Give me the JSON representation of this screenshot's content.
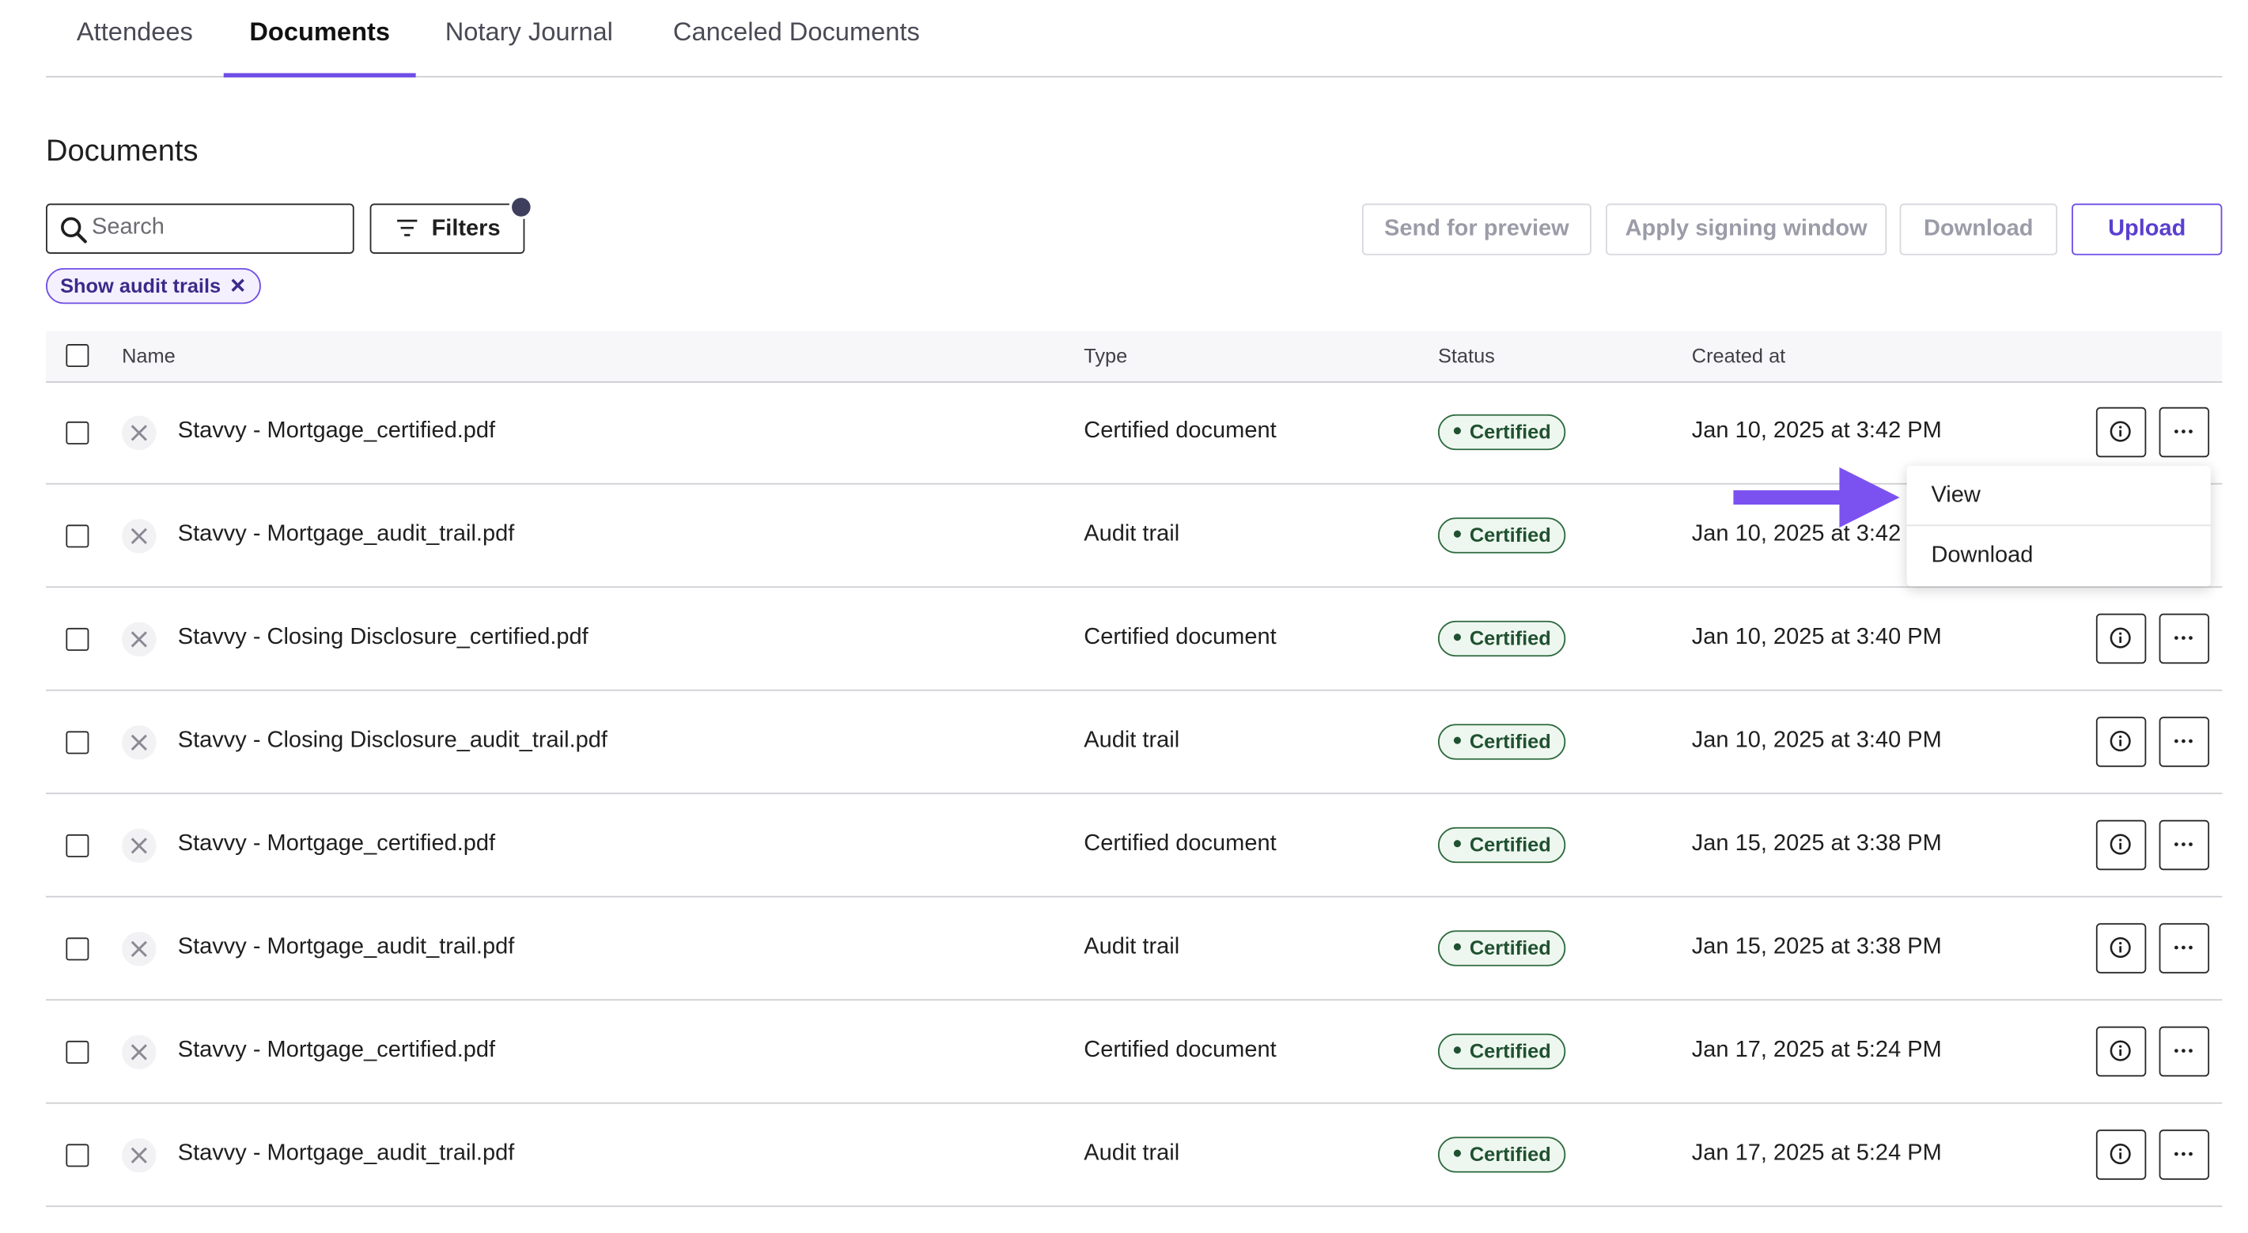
{
  "tabs": [
    {
      "label": "Attendees",
      "active": false
    },
    {
      "label": "Documents",
      "active": true
    },
    {
      "label": "Notary Journal",
      "active": false
    },
    {
      "label": "Canceled Documents",
      "active": false
    }
  ],
  "section_title": "Documents",
  "search": {
    "placeholder": "Search",
    "value": ""
  },
  "filters": {
    "label": "Filters",
    "has_active": true
  },
  "chip": {
    "label": "Show audit trails"
  },
  "actions": {
    "send_for_preview": "Send for preview",
    "apply_signing_window": "Apply signing window",
    "download": "Download",
    "upload": "Upload"
  },
  "table": {
    "headers": {
      "name": "Name",
      "type": "Type",
      "status": "Status",
      "created_at": "Created at"
    },
    "rows": [
      {
        "name": "Stavvy - Mortgage_certified.pdf",
        "type": "Certified document",
        "status": "Certified",
        "created_at": "Jan 10, 2025 at 3:42 PM"
      },
      {
        "name": "Stavvy - Mortgage_audit_trail.pdf",
        "type": "Audit trail",
        "status": "Certified",
        "created_at": "Jan 10, 2025 at 3:42"
      },
      {
        "name": "Stavvy - Closing Disclosure_certified.pdf",
        "type": "Certified document",
        "status": "Certified",
        "created_at": "Jan 10, 2025 at 3:40 PM"
      },
      {
        "name": "Stavvy - Closing Disclosure_audit_trail.pdf",
        "type": "Audit trail",
        "status": "Certified",
        "created_at": "Jan 10, 2025 at 3:40 PM"
      },
      {
        "name": "Stavvy - Mortgage_certified.pdf",
        "type": "Certified document",
        "status": "Certified",
        "created_at": "Jan 15, 2025 at 3:38 PM"
      },
      {
        "name": "Stavvy - Mortgage_audit_trail.pdf",
        "type": "Audit trail",
        "status": "Certified",
        "created_at": "Jan 15, 2025 at 3:38 PM"
      },
      {
        "name": "Stavvy - Mortgage_certified.pdf",
        "type": "Certified document",
        "status": "Certified",
        "created_at": "Jan 17, 2025 at 5:24 PM"
      },
      {
        "name": "Stavvy - Mortgage_audit_trail.pdf",
        "type": "Audit trail",
        "status": "Certified",
        "created_at": "Jan 17, 2025 at 5:24 PM"
      }
    ]
  },
  "context_menu": {
    "items": [
      "View",
      "Download"
    ]
  },
  "colors": {
    "accent": "#6f4ee6",
    "status_green": "#2d6a3e",
    "arrow": "#7b52f0"
  },
  "icons": {
    "search": "search-icon",
    "filter": "filter-icon",
    "close": "close-icon",
    "file": "file-icon",
    "info": "info-icon",
    "more": "more-icon",
    "arrow": "arrow-right-icon"
  }
}
